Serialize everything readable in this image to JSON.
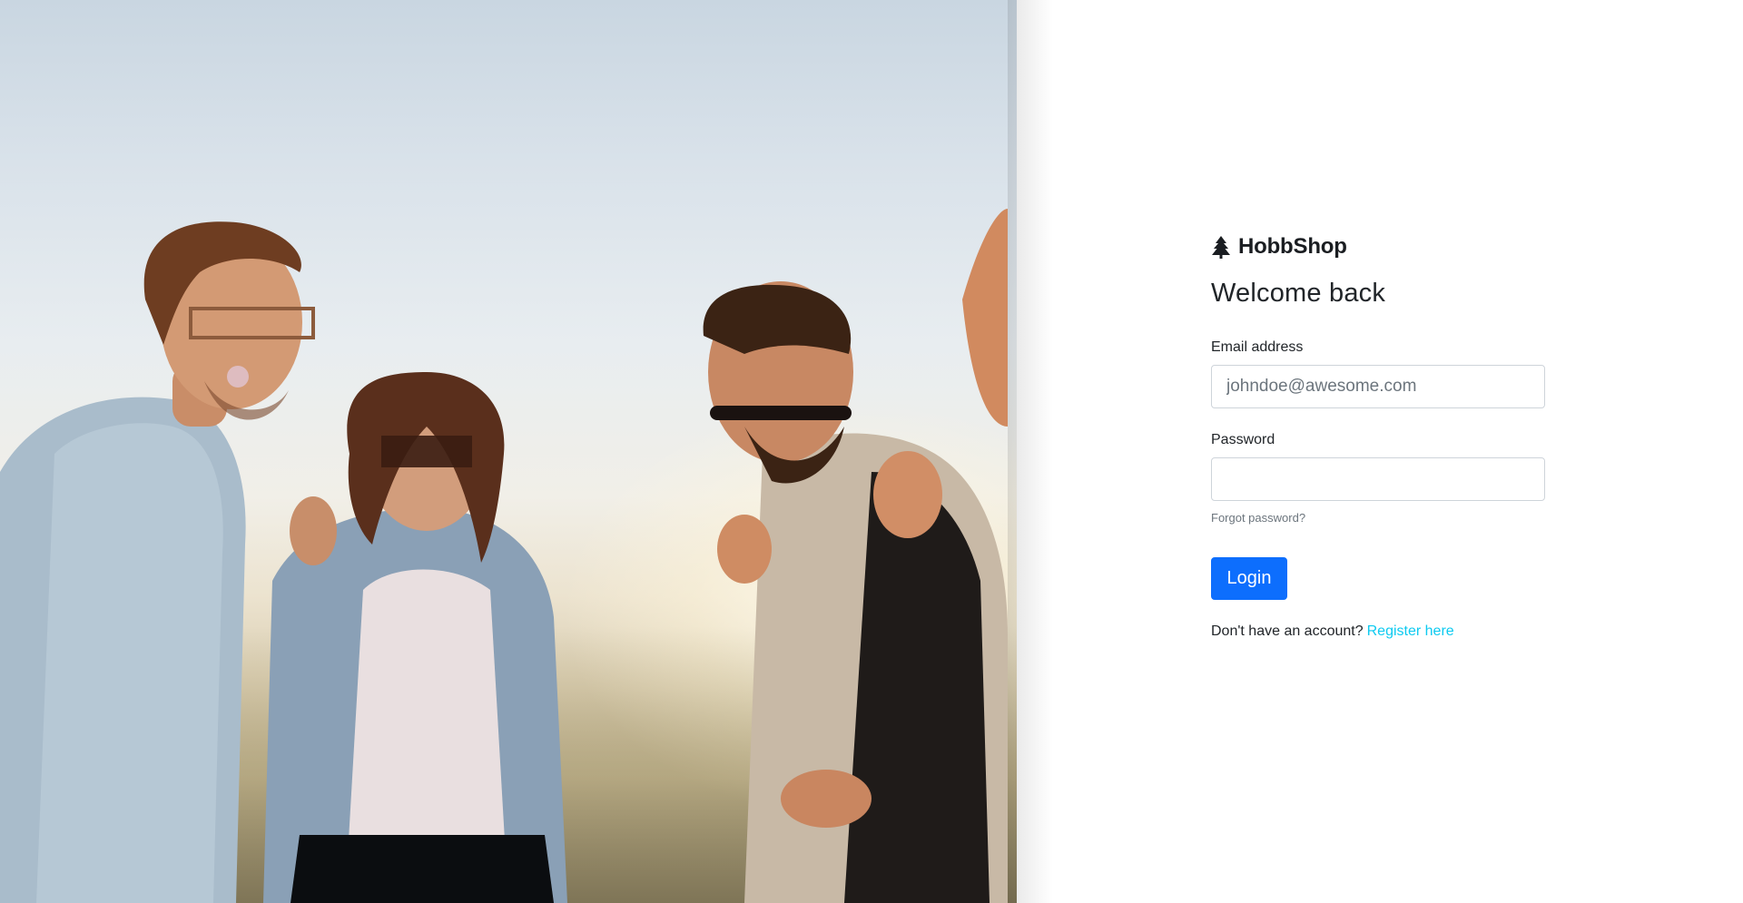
{
  "hero": {
    "image_subject": "group-of-friends-photo"
  },
  "brand": {
    "name": "HobbShop",
    "icon": "tree-icon"
  },
  "login": {
    "heading": "Welcome back",
    "email_label": "Email address",
    "email_placeholder": "johndoe@awesome.com",
    "email_value": "",
    "password_label": "Password",
    "password_value": "",
    "forgot_label": "Forgot password?",
    "submit_label": "Login",
    "register_prompt": "Don't have an account?",
    "register_link": "Register here"
  },
  "colors": {
    "primary": "#0d6efd",
    "link": "#0dcaf0",
    "text": "#212529",
    "muted": "#6c757d"
  }
}
